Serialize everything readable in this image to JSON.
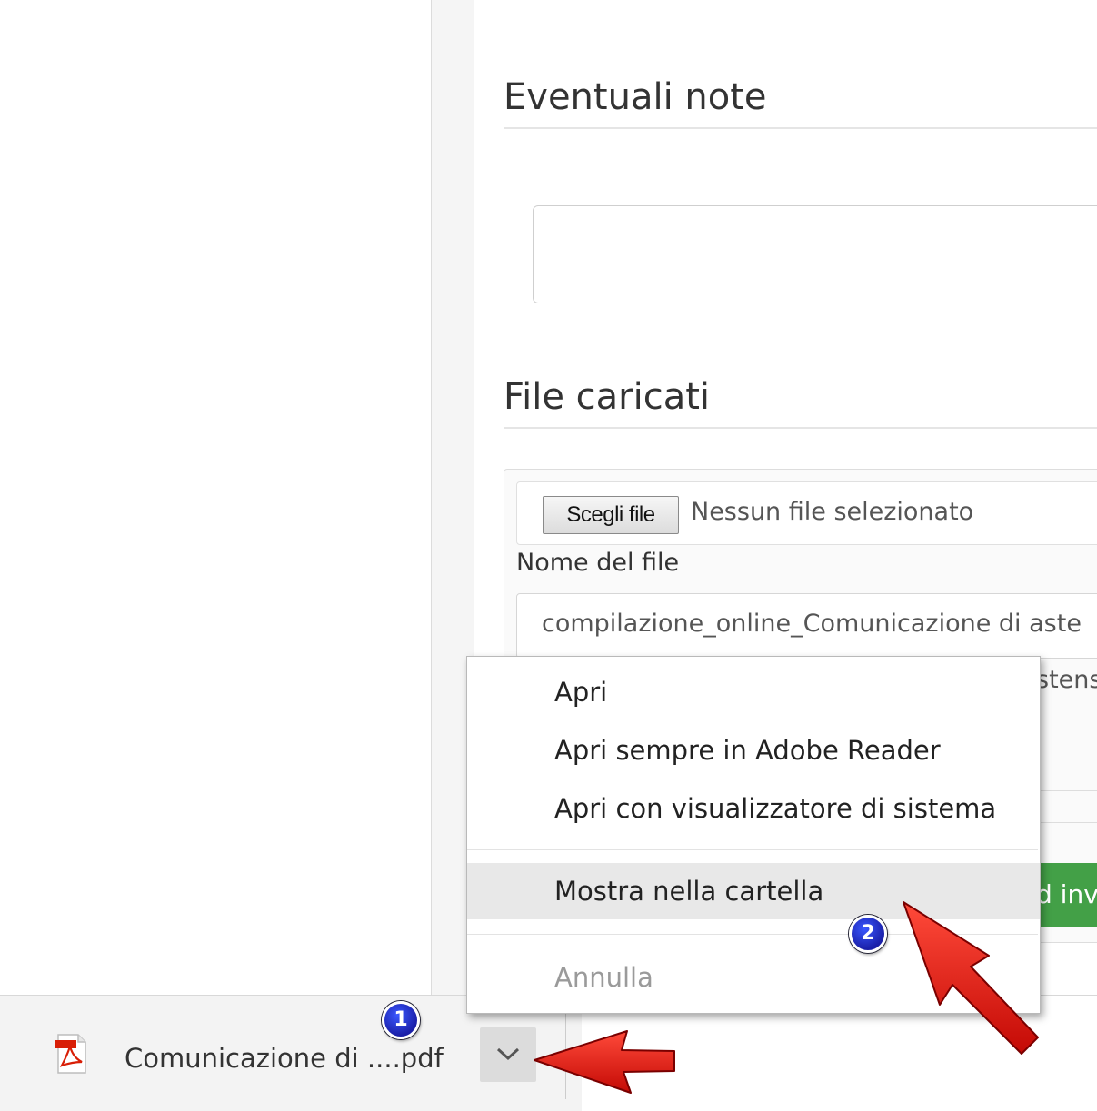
{
  "notes_section": {
    "title": "Eventuali note"
  },
  "files_section": {
    "title": "File caricati",
    "choose_file_button": "Scegli file",
    "no_file_selected": "Nessun file selezionato",
    "file_name_label": "Nome del file",
    "file_name_value": "compilazione_online_Comunicazione di aste",
    "partial_row_text": "stens",
    "submit_partial": "d inv"
  },
  "context_menu": {
    "items": [
      {
        "label": "Apri",
        "state": "normal"
      },
      {
        "label": "Apri sempre in Adobe Reader",
        "state": "normal"
      },
      {
        "label": "Apri con visualizzatore di sistema",
        "state": "normal"
      },
      {
        "label": "Mostra nella cartella",
        "state": "highlighted"
      },
      {
        "label": "Annulla",
        "state": "disabled"
      }
    ]
  },
  "download_bar": {
    "file_icon": "pdf-file-icon",
    "file_name": "Comunicazione di ....pdf",
    "menu_icon": "chevron-down-icon"
  },
  "annotations": {
    "badges": [
      "1",
      "2"
    ],
    "arrow_color": "#e0140f",
    "badge_color": "#1f2fd6"
  },
  "colors": {
    "highlight": "#e8e8e8",
    "disabled_text": "#9a9a9a",
    "submit_green": "#43a047"
  }
}
